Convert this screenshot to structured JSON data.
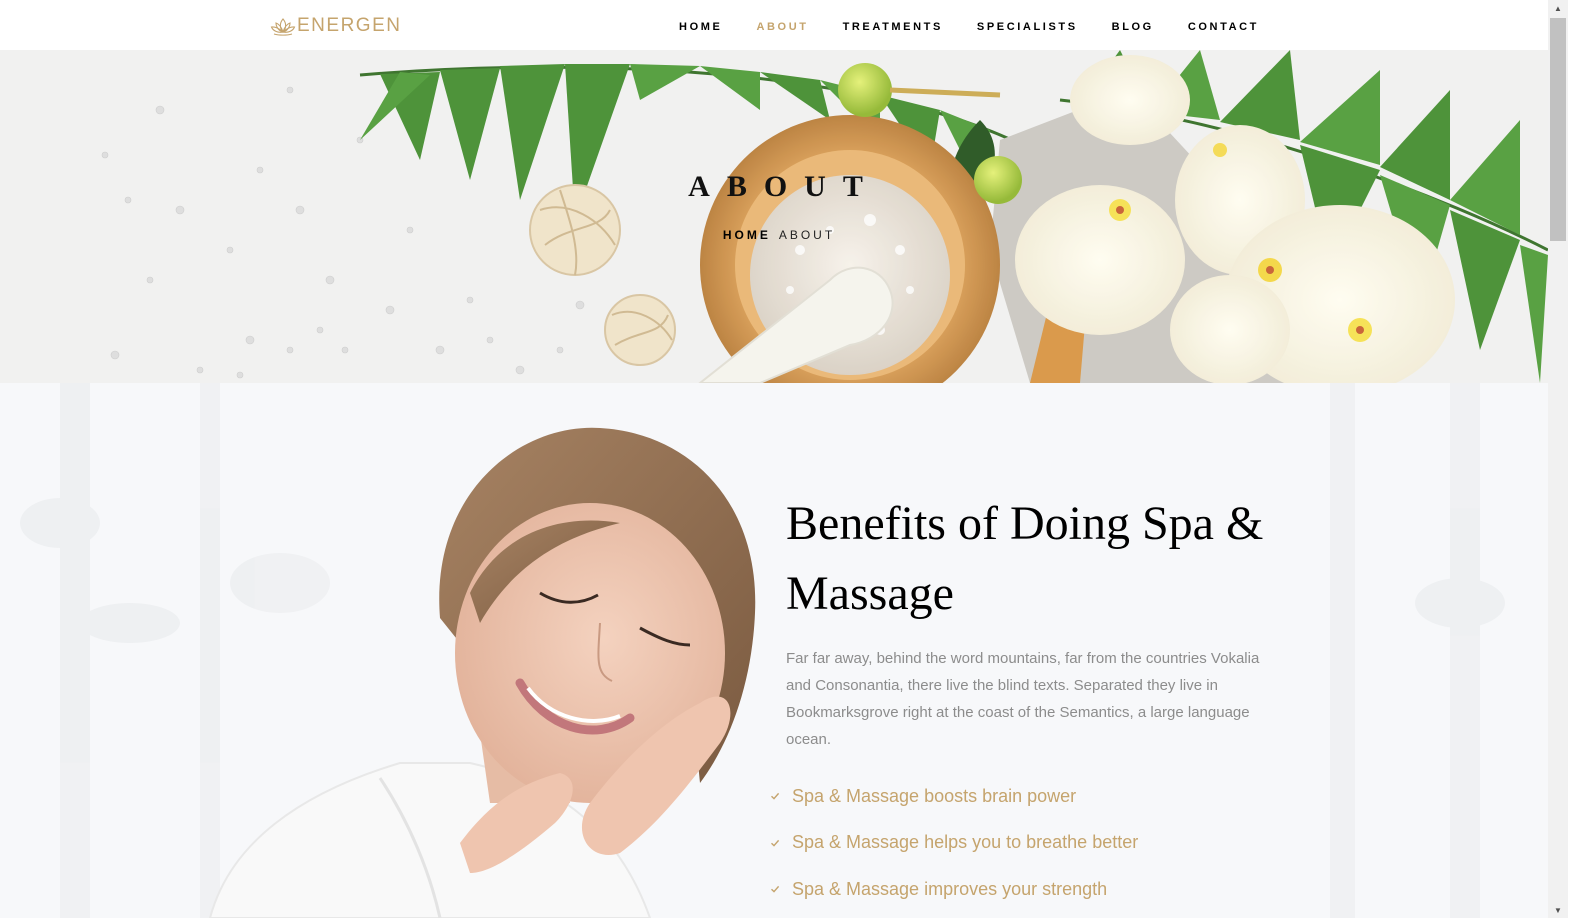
{
  "brand": {
    "name": "ENERGEN",
    "icon": "lotus-icon"
  },
  "nav": {
    "items": [
      {
        "label": "HOME",
        "active": false
      },
      {
        "label": "ABOUT",
        "active": true
      },
      {
        "label": "TREATMENTS",
        "active": false
      },
      {
        "label": "SPECIALISTS",
        "active": false
      },
      {
        "label": "BLOG",
        "active": false
      },
      {
        "label": "CONTACT",
        "active": false
      }
    ]
  },
  "hero": {
    "title": "ABOUT",
    "breadcrumb": {
      "home": "HOME",
      "current": "ABOUT"
    }
  },
  "about": {
    "heading": "Benefits of Doing Spa & Massage",
    "paragraph": "Far far away, behind the word mountains, far from the countries Vokalia and Consonantia, there live the blind texts. Separated they live in Bookmarksgrove right at the coast of the Semantics, a large language ocean.",
    "benefits": [
      "Spa & Massage boosts brain power",
      "Spa & Massage helps you to breathe better",
      "Spa & Massage improves your strength"
    ]
  },
  "colors": {
    "accent": "#c5a46d",
    "text_dark": "#000000",
    "text_muted": "#8c8c8c",
    "leaf_green": "#3f8a2a",
    "bowl_wood": "#d99a4a"
  },
  "icons": {
    "check": "check-icon",
    "scroll_up": "arrow-up-icon",
    "scroll_down": "arrow-down-icon"
  }
}
